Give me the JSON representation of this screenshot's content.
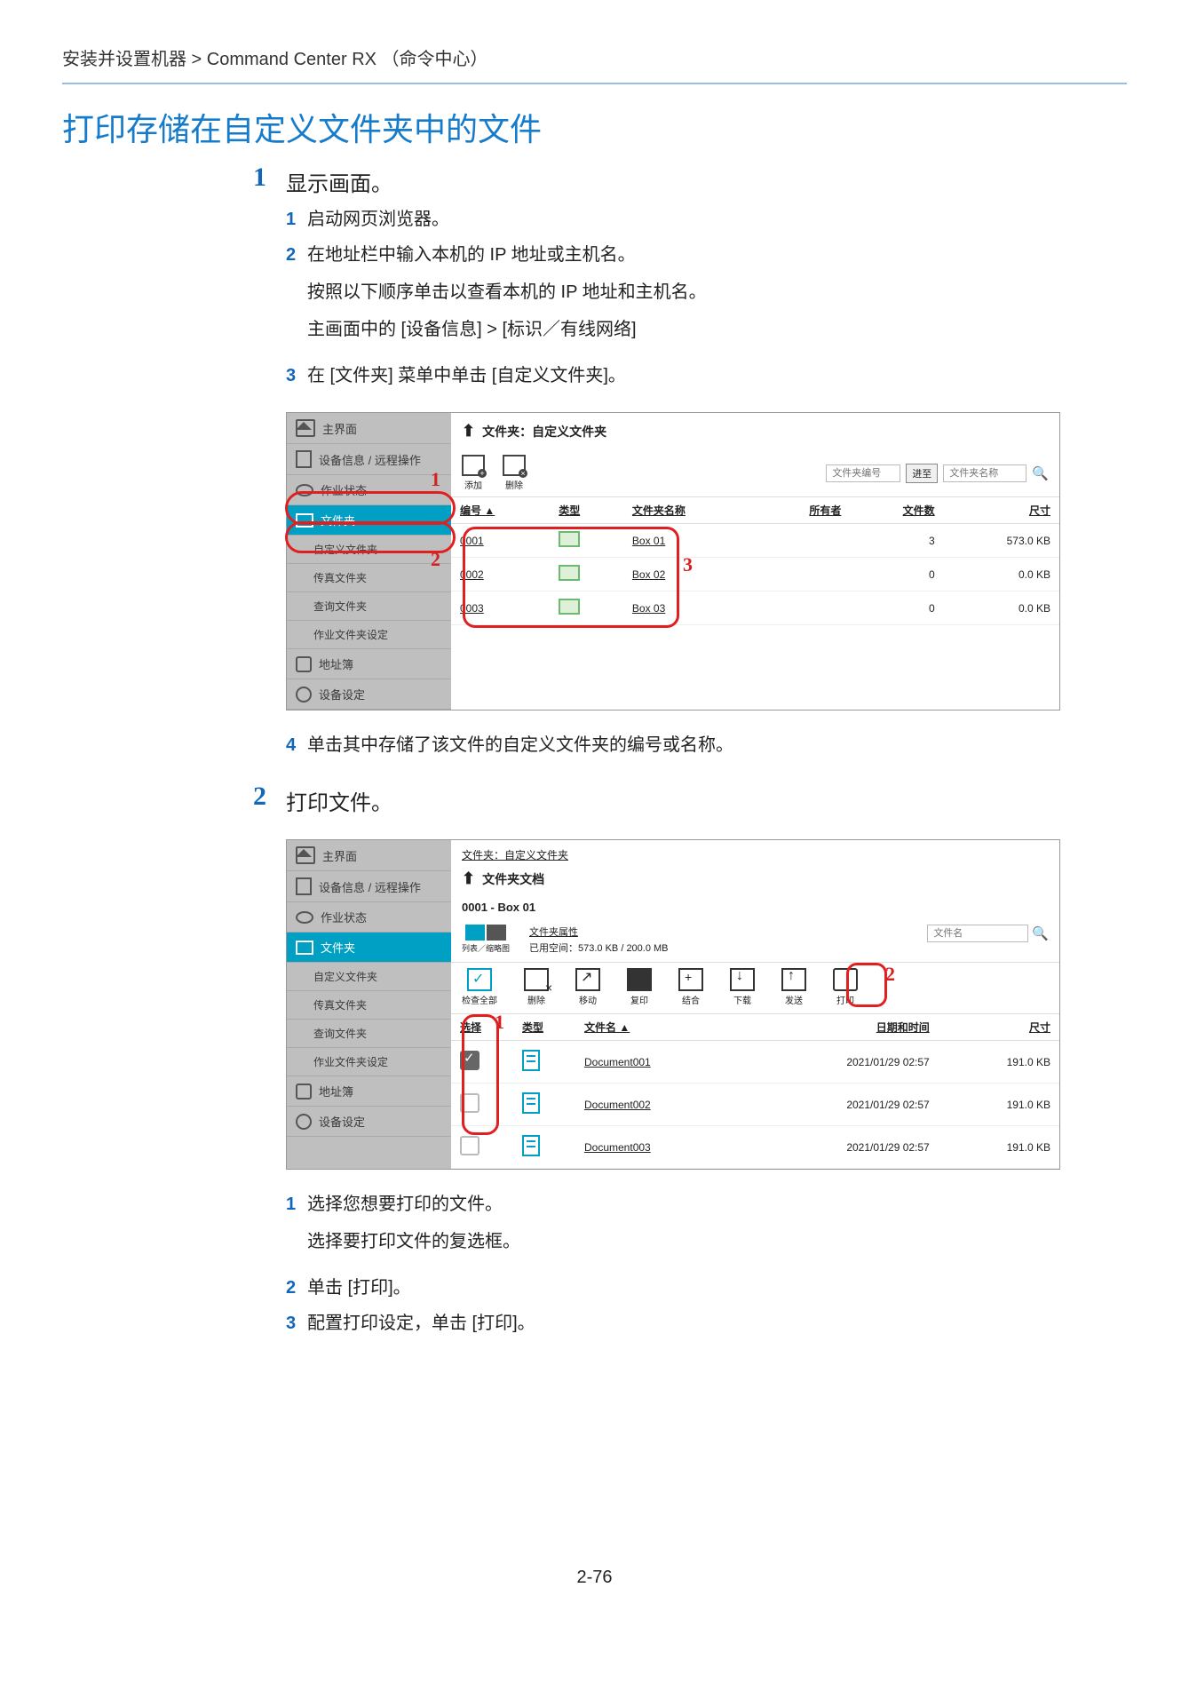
{
  "breadcrumb": "安装并设置机器 > Command Center RX （命令中心）",
  "title": "打印存储在自定义文件夹中的文件",
  "step1": {
    "num": "1",
    "heading": "显示画面。",
    "items": {
      "i1": {
        "n": "1",
        "t": "启动网页浏览器。"
      },
      "i2": {
        "n": "2",
        "l1": "在地址栏中输入本机的 IP 地址或主机名。",
        "l2": "按照以下顺序单击以查看本机的 IP 地址和主机名。",
        "l3": "主画面中的 [设备信息] > [标识／有线网络]"
      },
      "i3": {
        "n": "3",
        "t": "在 [文件夹] 菜单中单击 [自定义文件夹]。"
      },
      "i4": {
        "n": "4",
        "t": "单击其中存储了该文件的自定义文件夹的编号或名称。"
      }
    }
  },
  "step2": {
    "num": "2",
    "heading": "打印文件。",
    "items": {
      "i1": {
        "n": "1",
        "l1": "选择您想要打印的文件。",
        "l2": "选择要打印文件的复选框。"
      },
      "i2": {
        "n": "2",
        "t": "单击 [打印]。"
      },
      "i3": {
        "n": "3",
        "t": "配置打印设定，单击 [打印]。"
      }
    }
  },
  "scr1": {
    "nav": {
      "home": "主界面",
      "devinfo": "设备信息 / 远程操作",
      "jobstatus": "作业状态",
      "box": "文件夹",
      "custom": "自定义文件夹",
      "fax": "传真文件夹",
      "polling": "查询文件夹",
      "jobbox": "作业文件夹设定",
      "address": "地址簿",
      "device": "设备设定"
    },
    "hdr_arrow": "⬆",
    "hdr": "文件夹：自定义文件夹",
    "tb": {
      "add": "添加",
      "del": "删除"
    },
    "search": {
      "num_ph": "文件夹编号",
      "go": "进至",
      "name_ph": "文件夹名称"
    },
    "cols": {
      "num": "编号 ▲",
      "type": "类型",
      "name": "文件夹名称",
      "owner": "所有者",
      "files": "文件数",
      "size": "尺寸"
    },
    "rows": [
      {
        "num": "0001",
        "name": "Box 01",
        "files": "3",
        "size": "573.0 KB"
      },
      {
        "num": "0002",
        "name": "Box 02",
        "files": "0",
        "size": "0.0 KB"
      },
      {
        "num": "0003",
        "name": "Box 03",
        "files": "0",
        "size": "0.0 KB"
      }
    ],
    "callouts": {
      "c1": "1",
      "c2": "2",
      "c3": "3"
    }
  },
  "scr2": {
    "nav": {
      "home": "主界面",
      "devinfo": "设备信息 / 远程操作",
      "jobstatus": "作业状态",
      "box": "文件夹",
      "custom": "自定义文件夹",
      "fax": "传真文件夹",
      "polling": "查询文件夹",
      "jobbox": "作业文件夹设定",
      "address": "地址簿",
      "device": "设备设定"
    },
    "crumb": "文件夹：自定义文件夹",
    "hdr_arrow": "⬆",
    "hdr": "文件夹文档",
    "sub": "0001 - Box 01",
    "view_label": "列表／缩略图",
    "props": "文件夹属性",
    "used": "已用空间：573.0 KB / 200.0 MB",
    "file_ph": "文件名",
    "actions": {
      "check": "检查全部",
      "del": "删除",
      "move": "移动",
      "copy": "复印",
      "combine": "结合",
      "download": "下载",
      "send": "发送",
      "print": "打印"
    },
    "cols": {
      "sel": "选择",
      "type": "类型",
      "name": "文件名 ▲",
      "date": "日期和时间",
      "size": "尺寸"
    },
    "rows": [
      {
        "name": "Document001",
        "date": "2021/01/29 02:57",
        "size": "191.0 KB",
        "checked": true
      },
      {
        "name": "Document002",
        "date": "2021/01/29 02:57",
        "size": "191.0 KB",
        "checked": false
      },
      {
        "name": "Document003",
        "date": "2021/01/29 02:57",
        "size": "191.0 KB",
        "checked": false
      }
    ],
    "callouts": {
      "c1": "1",
      "c2": "2"
    }
  },
  "page_num": "2-76"
}
